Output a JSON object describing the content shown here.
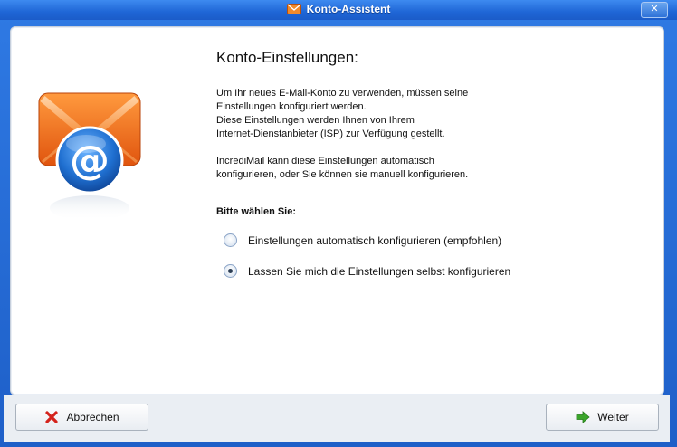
{
  "window": {
    "title": "Konto-Assistent",
    "close_label": "✕"
  },
  "main": {
    "section_title": "Konto-Einstellungen:",
    "paragraph1_lines": [
      "Um Ihr neues E-Mail-Konto zu verwenden, müssen seine",
      "Einstellungen konfiguriert werden.",
      "Diese Einstellungen werden Ihnen von Ihrem",
      "Internet-Dienstanbieter (ISP) zur Verfügung gestellt."
    ],
    "paragraph2_lines": [
      "IncrediMail kann diese Einstellungen automatisch",
      "konfigurieren, oder Sie können sie manuell konfigurieren."
    ],
    "choose_label": "Bitte wählen Sie:",
    "options": [
      {
        "label": "Einstellungen automatisch konfigurieren (empfohlen)",
        "selected": false
      },
      {
        "label": "Lassen Sie mich die Einstellungen selbst konfigurieren",
        "selected": true
      }
    ]
  },
  "footer": {
    "cancel_label": "Abbrechen",
    "next_label": "Weiter"
  },
  "icons": {
    "illustration": "email-at-icon",
    "cancel": "red-x-icon",
    "next": "green-arrow-right-icon"
  },
  "colors": {
    "title_bar": "#1f66d6",
    "envelope": "#f27a1a",
    "at_circle": "#1f6fd0",
    "cancel_icon": "#d4231c",
    "next_icon": "#3aa52a"
  }
}
